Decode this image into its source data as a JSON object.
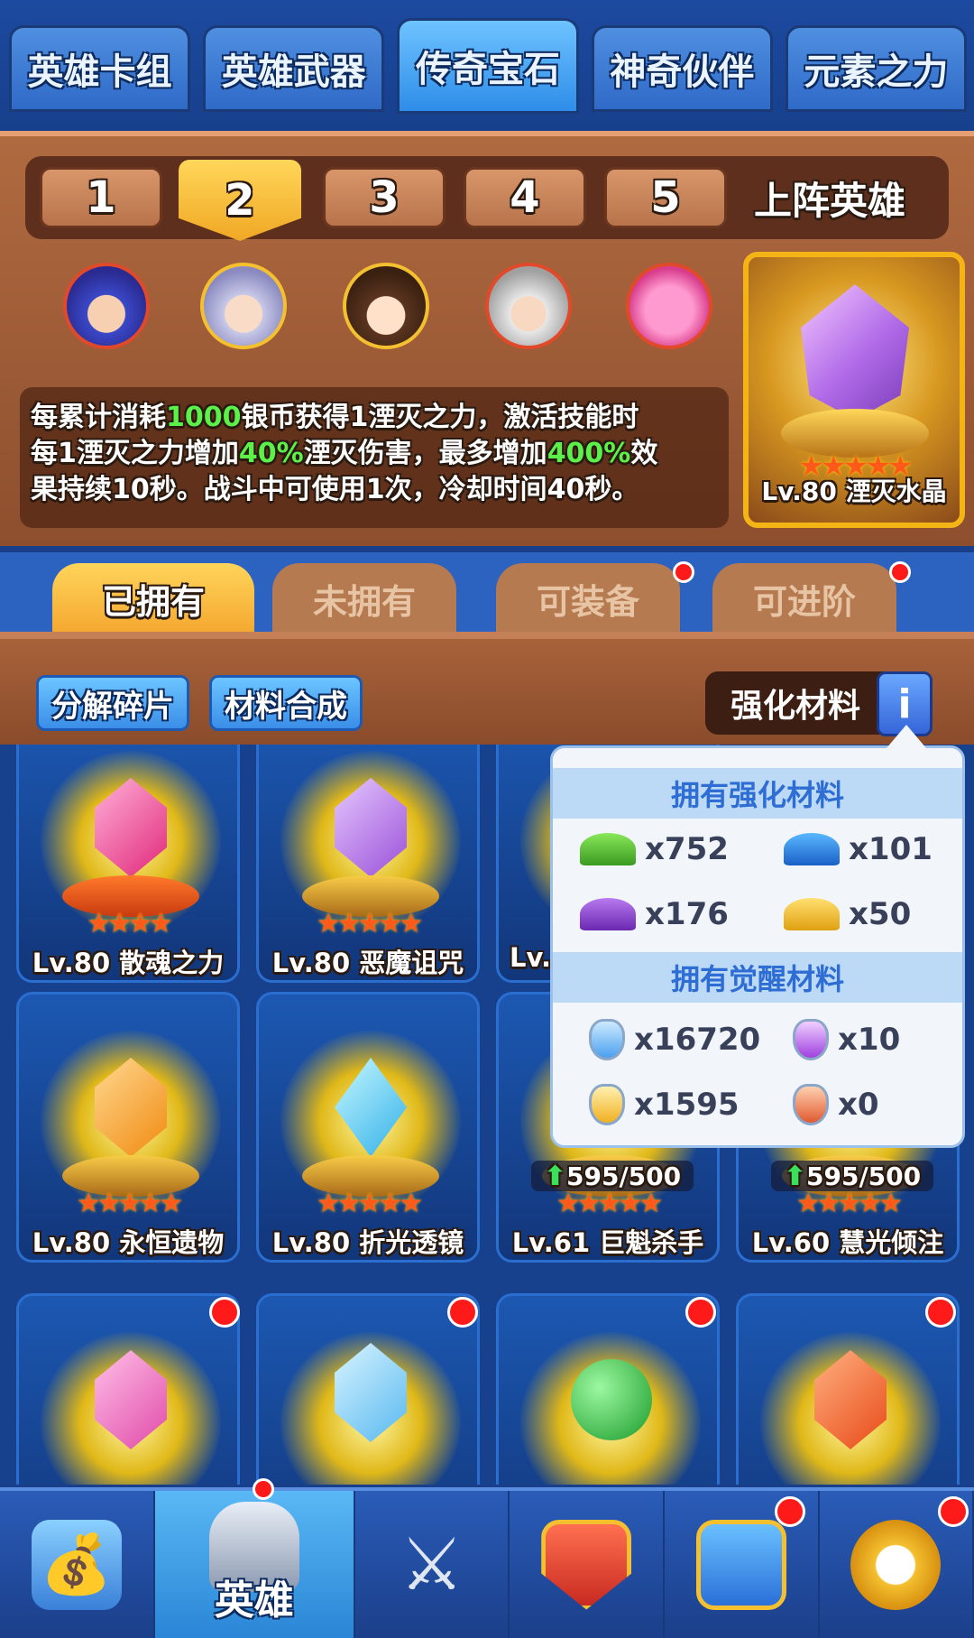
{
  "top_tabs": [
    "英雄卡组",
    "英雄武器",
    "传奇宝石",
    "神奇伙伴",
    "元素之力"
  ],
  "top_tab_active": 2,
  "number_tabs": [
    "1",
    "2",
    "3",
    "4",
    "5"
  ],
  "number_tab_active": 1,
  "deploy_label": "上阵英雄",
  "description": {
    "line1_a": "每累计消耗",
    "line1_b": "1000",
    "line1_c": "银币获得1湮灭之力，激活技能时",
    "line2_a": "每1湮灭之力增加",
    "line2_b": "40%",
    "line2_c": "湮灭伤害，最多增加",
    "line2_d": "400%",
    "line2_e": "效",
    "line3": "果持续10秒。战斗中可使用1次，冷却时间40秒。"
  },
  "featured_gem": {
    "label": "Lv.80 湮灭水晶",
    "stars": "★★★★★"
  },
  "ownership_tabs": [
    "已拥有",
    "未拥有",
    "可装备",
    "可进阶"
  ],
  "ownership_active": 0,
  "tools": {
    "decompose": "分解碎片",
    "synthesize": "材料合成",
    "enhance_materials": "强化材料",
    "info": "i"
  },
  "popup": {
    "enhance_title": "拥有强化材料",
    "enhance_items": [
      "x752",
      "x101",
      "x176",
      "x50"
    ],
    "awaken_title": "拥有觉醒材料",
    "awaken_items": [
      "x16720",
      "x10",
      "x1595",
      "x0"
    ]
  },
  "gems": [
    {
      "name": "Lv.80 散魂之力",
      "stars": "★★★★"
    },
    {
      "name": "Lv.80 恶魔诅咒",
      "stars": "★★★★★"
    },
    {
      "name": "Lv.",
      "stars": ""
    },
    {
      "name": "Lv.80 永恒遗物",
      "stars": "★★★★★"
    },
    {
      "name": "Lv.80 折光透镜",
      "stars": "★★★★★"
    },
    {
      "name": "Lv.61 巨魁杀手",
      "stars": "★★★★★",
      "progress": "595/500"
    },
    {
      "name": "Lv.60 慧光倾注",
      "stars": "★★★★★",
      "progress": "595/500"
    }
  ],
  "nav": {
    "hero_label": "英雄"
  },
  "colors": {
    "accent_yellow": "#f4b416",
    "green_text": "#5cf04a",
    "red_dot": "#ff1a1a"
  }
}
